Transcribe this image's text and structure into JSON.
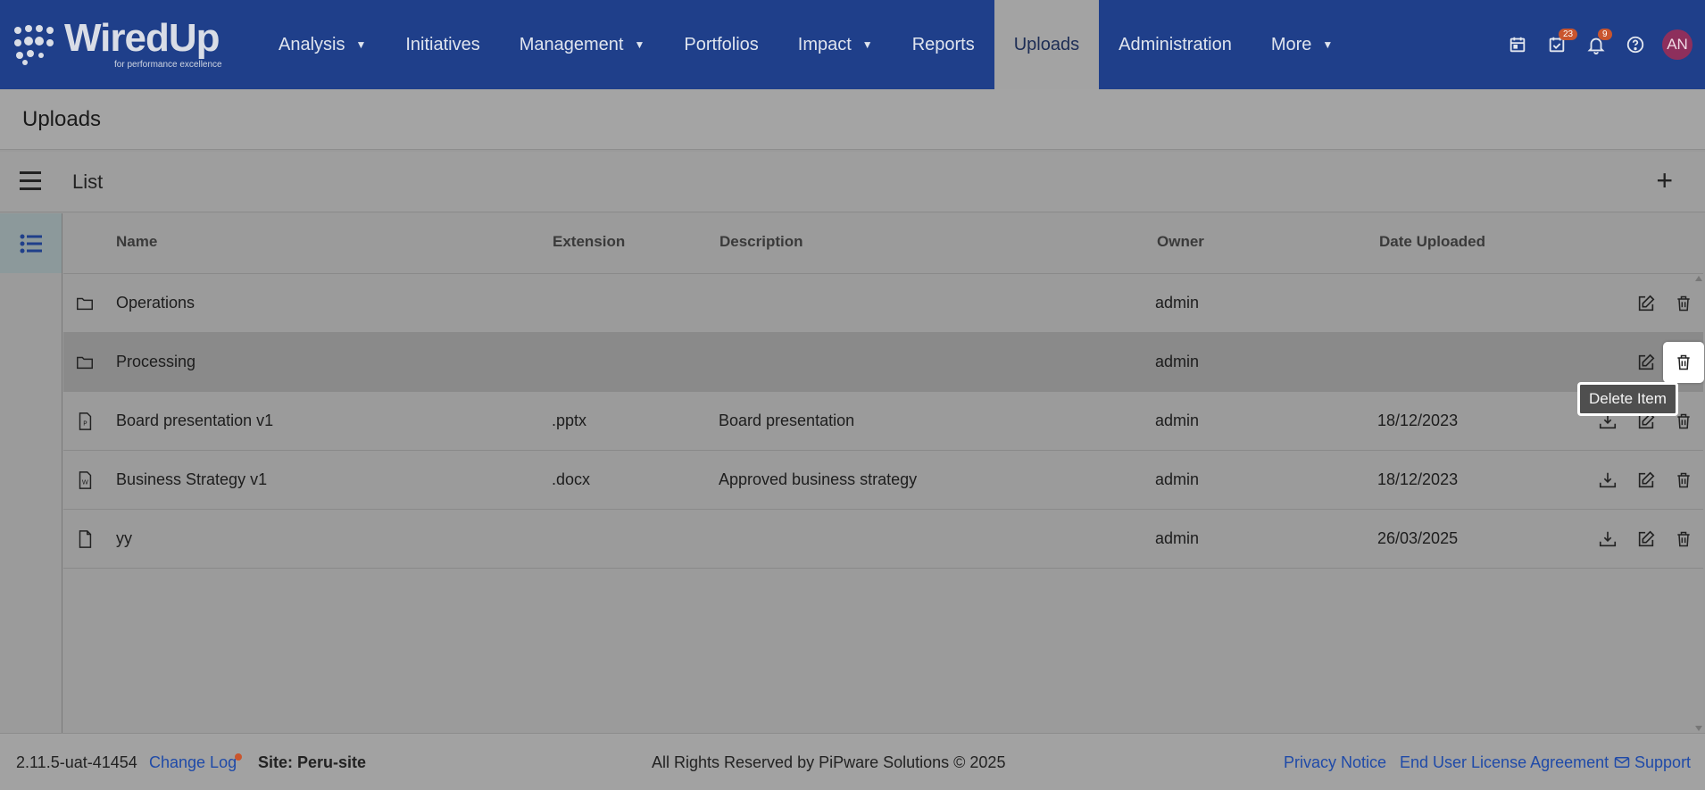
{
  "brand": {
    "name": "WiredUp",
    "tagline": "for performance excellence"
  },
  "nav": [
    {
      "label": "Analysis",
      "dropdown": true
    },
    {
      "label": "Initiatives",
      "dropdown": false
    },
    {
      "label": "Management",
      "dropdown": true
    },
    {
      "label": "Portfolios",
      "dropdown": false
    },
    {
      "label": "Impact",
      "dropdown": true
    },
    {
      "label": "Reports",
      "dropdown": false
    },
    {
      "label": "Uploads",
      "dropdown": false,
      "active": true
    },
    {
      "label": "Administration",
      "dropdown": false
    },
    {
      "label": "More",
      "dropdown": true
    }
  ],
  "top_icons": {
    "calendar": "calendar-icon",
    "tasks": {
      "icon": "tasks-check-icon",
      "badge": "23"
    },
    "notifications": {
      "icon": "bell-icon",
      "badge": "9"
    },
    "help": "help-icon",
    "avatar_initials": "AN"
  },
  "page": {
    "title": "Uploads"
  },
  "list": {
    "title": "List"
  },
  "table": {
    "columns": [
      "Name",
      "Extension",
      "Description",
      "Owner",
      "Date Uploaded"
    ],
    "rows": [
      {
        "icon": "folder-icon",
        "name": "Operations",
        "extension": "",
        "description": "",
        "owner": "admin",
        "date": "",
        "download": false
      },
      {
        "icon": "folder-icon",
        "name": "Processing",
        "extension": "",
        "description": "",
        "owner": "admin",
        "date": "",
        "download": false
      },
      {
        "icon": "pptx-file-icon",
        "name": "Board presentation v1",
        "extension": ".pptx",
        "description": "Board presentation",
        "owner": "admin",
        "date": "18/12/2023",
        "download": true
      },
      {
        "icon": "docx-file-icon",
        "name": "Business Strategy v1",
        "extension": ".docx",
        "description": "Approved business strategy",
        "owner": "admin",
        "date": "18/12/2023",
        "download": true
      },
      {
        "icon": "file-icon",
        "name": "yy",
        "extension": "",
        "description": "",
        "owner": "admin",
        "date": "26/03/2025",
        "download": true
      }
    ]
  },
  "tooltip": "Delete Item",
  "footer": {
    "version": "2.11.5-uat-41454",
    "change_log": "Change Log",
    "site": "Site: Peru-site",
    "copyright": "All Rights Reserved by PiPware Solutions © 2025",
    "privacy": "Privacy Notice",
    "eula": "End User License Agreement",
    "support": "Support"
  },
  "colors": {
    "nav_bg": "#1f3f8a",
    "accent_badge": "#c9552e",
    "link": "#1f4aa8"
  }
}
